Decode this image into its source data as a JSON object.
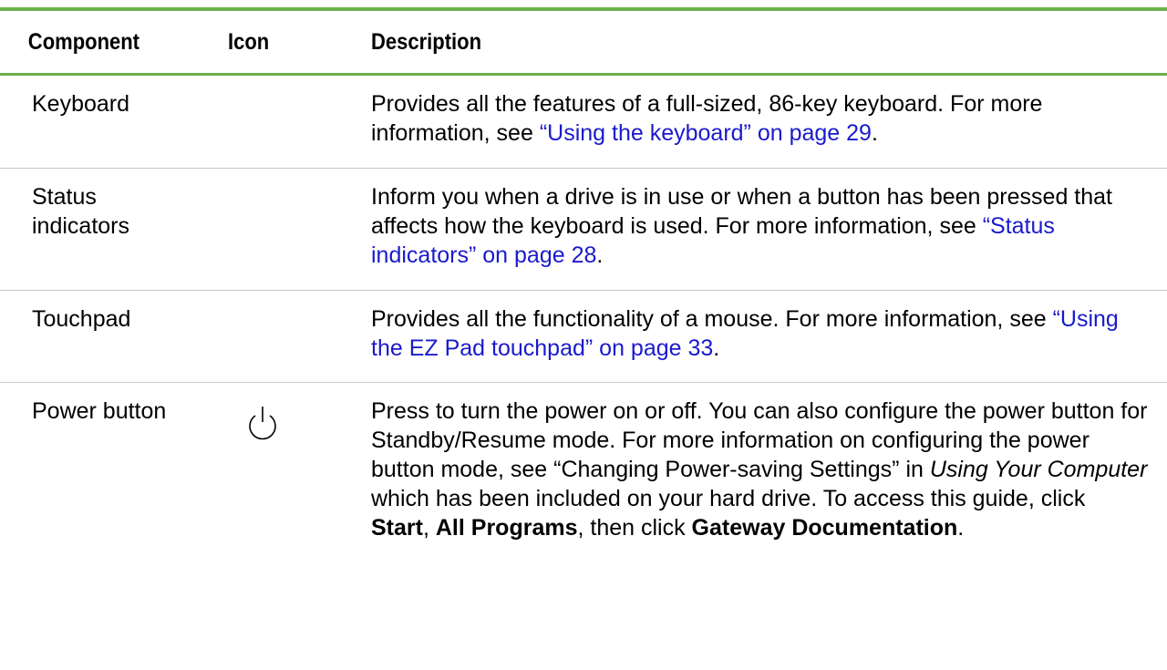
{
  "table": {
    "headers": {
      "component": "Component",
      "icon": "Icon",
      "description": "Description"
    },
    "rows": [
      {
        "component": "Keyboard",
        "icon": "",
        "desc_before": "Provides all the features of a full-sized, 86-key keyboard. For more information, see ",
        "desc_link": "“Using the keyboard” on page 29",
        "desc_after": "."
      },
      {
        "component": "Status indicators",
        "icon": "",
        "desc_before": "Inform you when a drive is in use or when a button has been pressed that affects how the keyboard is used. For more information, see ",
        "desc_link": "“Status indicators” on page 28",
        "desc_after": "."
      },
      {
        "component": "Touchpad",
        "icon": "",
        "desc_before": "Provides all the functionality of a mouse. For more information, see ",
        "desc_link": "“Using the EZ Pad touchpad” on page 33",
        "desc_after": "."
      },
      {
        "component": "Power button",
        "icon": "power-icon",
        "desc_1": "Press to turn the power on or off. You can also configure the power button for Standby/Resume mode. For more information on configuring the power button mode, see “Changing Power-saving Settings” in ",
        "desc_italic": "Using Your Computer",
        "desc_2": " which has been included on your hard drive. To access this guide, click ",
        "desc_bold_start": "Start",
        "desc_3": ", ",
        "desc_bold_programs": "All Programs",
        "desc_4": ", then click ",
        "desc_bold_docs": "Gateway Documentation",
        "desc_5": "."
      }
    ]
  },
  "colors": {
    "rule": "#6ab04c",
    "link": "#1a1acc",
    "divider": "#c8c8c8"
  }
}
